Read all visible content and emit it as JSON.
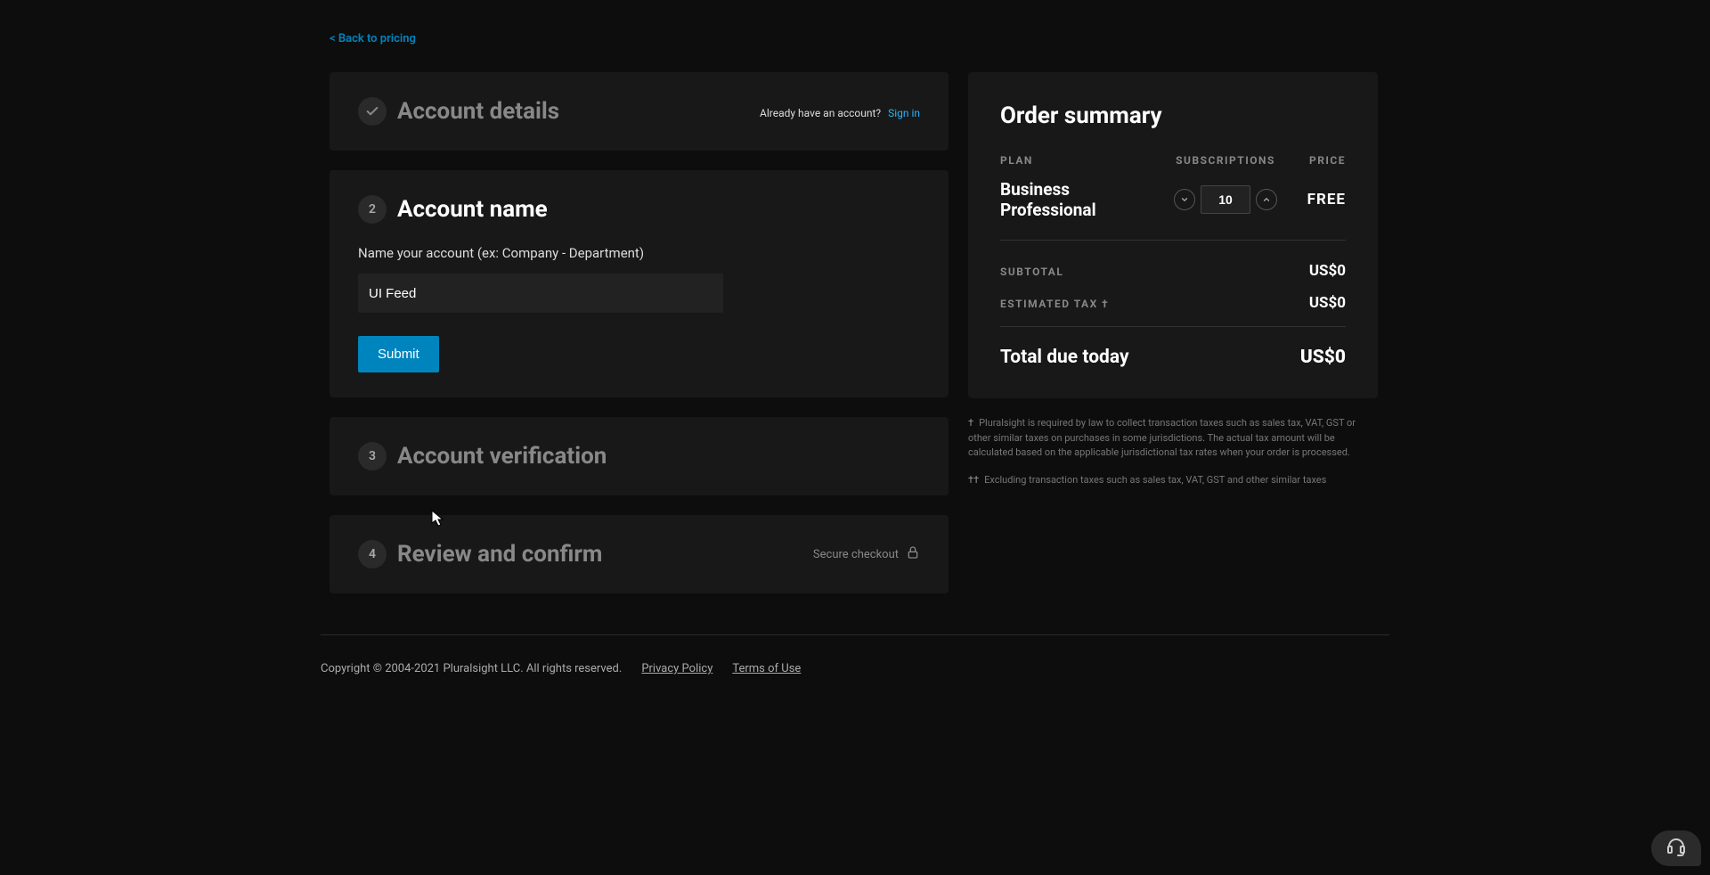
{
  "nav": {
    "back_link": "< Back to pricing"
  },
  "steps": {
    "s1": {
      "title": "Account details",
      "already_have": "Already have an account?",
      "sign_in": "Sign in"
    },
    "s2": {
      "number": "2",
      "title": "Account name",
      "field_label": "Name your account (ex: Company - Department)",
      "field_value": "UI Feed",
      "submit_label": "Submit"
    },
    "s3": {
      "number": "3",
      "title": "Account verification"
    },
    "s4": {
      "number": "4",
      "title": "Review and confirm",
      "secure_text": "Secure checkout"
    }
  },
  "summary": {
    "title": "Order summary",
    "headers": {
      "plan": "PLAN",
      "subs": "SUBSCRIPTIONS",
      "price": "PRICE"
    },
    "plan_name": "Business Professional",
    "subscriptions_value": "10",
    "price_value": "FREE",
    "subtotal_label": "SUBTOTAL",
    "subtotal_value": "US$0",
    "tax_label": "ESTIMATED TAX †",
    "tax_value": "US$0",
    "total_label": "Total due today",
    "total_value": "US$0"
  },
  "footnotes": {
    "f1_dagger": "†",
    "f1_text": "Pluralsight is required by law to collect transaction taxes such as sales tax, VAT, GST or other similar taxes on purchases in some jurisdictions. The actual tax amount will be calculated based on the applicable jurisdictional tax rates when your order is processed.",
    "f2_dagger": "††",
    "f2_text": "Excluding transaction taxes such as sales tax, VAT, GST and other similar taxes"
  },
  "footer": {
    "copyright": "Copyright © 2004-2021 Pluralsight LLC. All rights reserved.",
    "privacy": "Privacy Policy",
    "terms": "Terms of Use"
  }
}
